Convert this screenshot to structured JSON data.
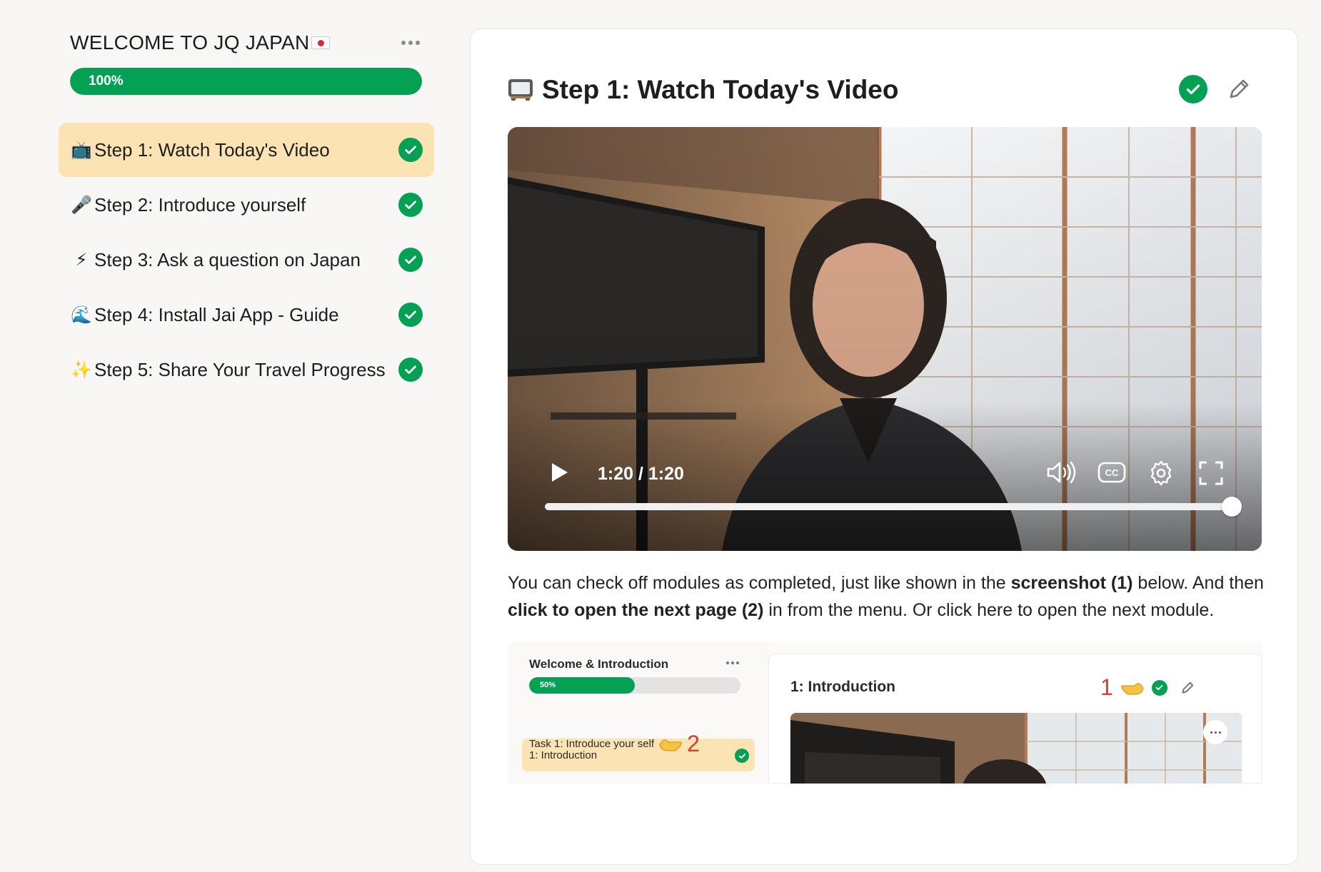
{
  "sidebar": {
    "title": "WELCOME TO JQ JAPAN",
    "progress_label": "100%",
    "progress_value": 1.0,
    "items": [
      {
        "emoji": "📺",
        "label": "Step 1: Watch Today's Video",
        "completed": true,
        "active": true
      },
      {
        "emoji": "🎤",
        "label": "Step 2: Introduce yourself",
        "completed": true,
        "active": false
      },
      {
        "emoji": "⚡",
        "label": "Step 3: Ask a question on Japan",
        "completed": true,
        "active": false
      },
      {
        "emoji": "🌊",
        "label": "Step 4: Install Jai App - Guide",
        "completed": true,
        "active": false
      },
      {
        "emoji": "✨",
        "label": "Step 5: Share Your Travel Progress",
        "completed": true,
        "active": false
      }
    ]
  },
  "main": {
    "title": "Step 1: Watch Today's Video",
    "video": {
      "time": "1:20 / 1:20",
      "progress_value": 1.0
    },
    "paragraph": {
      "p1": "You can check off modules as completed, just like shown in the ",
      "b1": "screenshot (1)",
      "p2": " below. And then ",
      "b2": "click to open the next page (2)",
      "p3": " in from the menu. Or click here to open the next module."
    },
    "embedded": {
      "sidebar_title": "Welcome & Introduction",
      "progress_label": "50%",
      "progress_value": 0.5,
      "item_1": "1: Introduction",
      "item_2": "Task 1: Introduce your self",
      "marker_2": "2",
      "main_title": "1: Introduction",
      "marker_1": "1"
    }
  },
  "colors": {
    "accent_green": "#04a155",
    "active_item_bg": "#fbe3b3",
    "page_bg": "#f8f7f5",
    "annotation_red": "#d93c32"
  }
}
